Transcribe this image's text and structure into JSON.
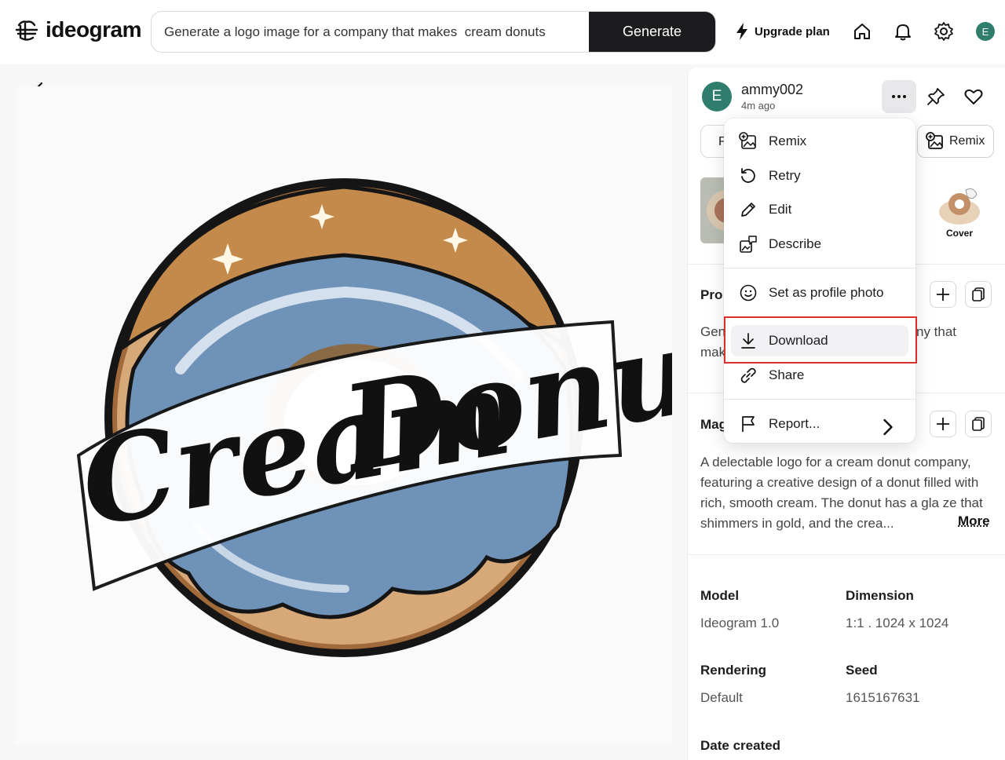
{
  "header": {
    "logo_text": "ideogram",
    "prompt_value": "Generate a logo image for a company that makes  cream donuts",
    "generate_label": "Generate",
    "upgrade_label": "Upgrade plan",
    "avatar_initial": "E",
    "icons": [
      "home-icon",
      "bell-icon",
      "gear-icon"
    ]
  },
  "panel": {
    "username": "ammy002",
    "time_ago": "4m ago",
    "avatar_initial": "E",
    "tab_partial": "P",
    "remix_tab_label": "Remix",
    "cover_label": "Cover",
    "prompt_head_partial": "Pro",
    "prompt_text_partial_1": "Gen",
    "prompt_text_partial_2": "mak",
    "prompt_text_tail": "ny that",
    "magic_head_partial": "Mag",
    "description": "A delectable logo for a cream donut company, featuring a creative design of a donut filled with rich, smooth cream. The donut has a gla ze that shimmers in gold, and the crea...",
    "more_label": "More",
    "meta": {
      "model_label": "Model",
      "model_value": "Ideogram 1.0",
      "dimension_label": "Dimension",
      "dimension_value": "1:1 . 1024 x 1024",
      "rendering_label": "Rendering",
      "rendering_value": "Default",
      "seed_label": "Seed",
      "seed_value": "1615167631",
      "date_label": "Date created"
    }
  },
  "menu": {
    "items": [
      {
        "label": "Remix",
        "icon": "remix-icon"
      },
      {
        "label": "Retry",
        "icon": "retry-icon"
      },
      {
        "label": "Edit",
        "icon": "pencil-icon"
      },
      {
        "label": "Describe",
        "icon": "describe-icon"
      },
      {
        "label": "Set as profile photo",
        "icon": "smiley-icon"
      },
      {
        "label": "Download",
        "icon": "download-icon"
      },
      {
        "label": "Share",
        "icon": "link-icon"
      },
      {
        "label": "Report...",
        "icon": "flag-icon"
      }
    ]
  },
  "artwork": {
    "wordmark_line1": "Cream",
    "wordmark_line2": "Donut"
  },
  "colors": {
    "accent_dark": "#1c1c1e",
    "avatar_green": "#2f7d6c",
    "highlight_red": "#d9302c",
    "donut_blue": "#6f93b8",
    "donut_gold": "#c8924f"
  }
}
